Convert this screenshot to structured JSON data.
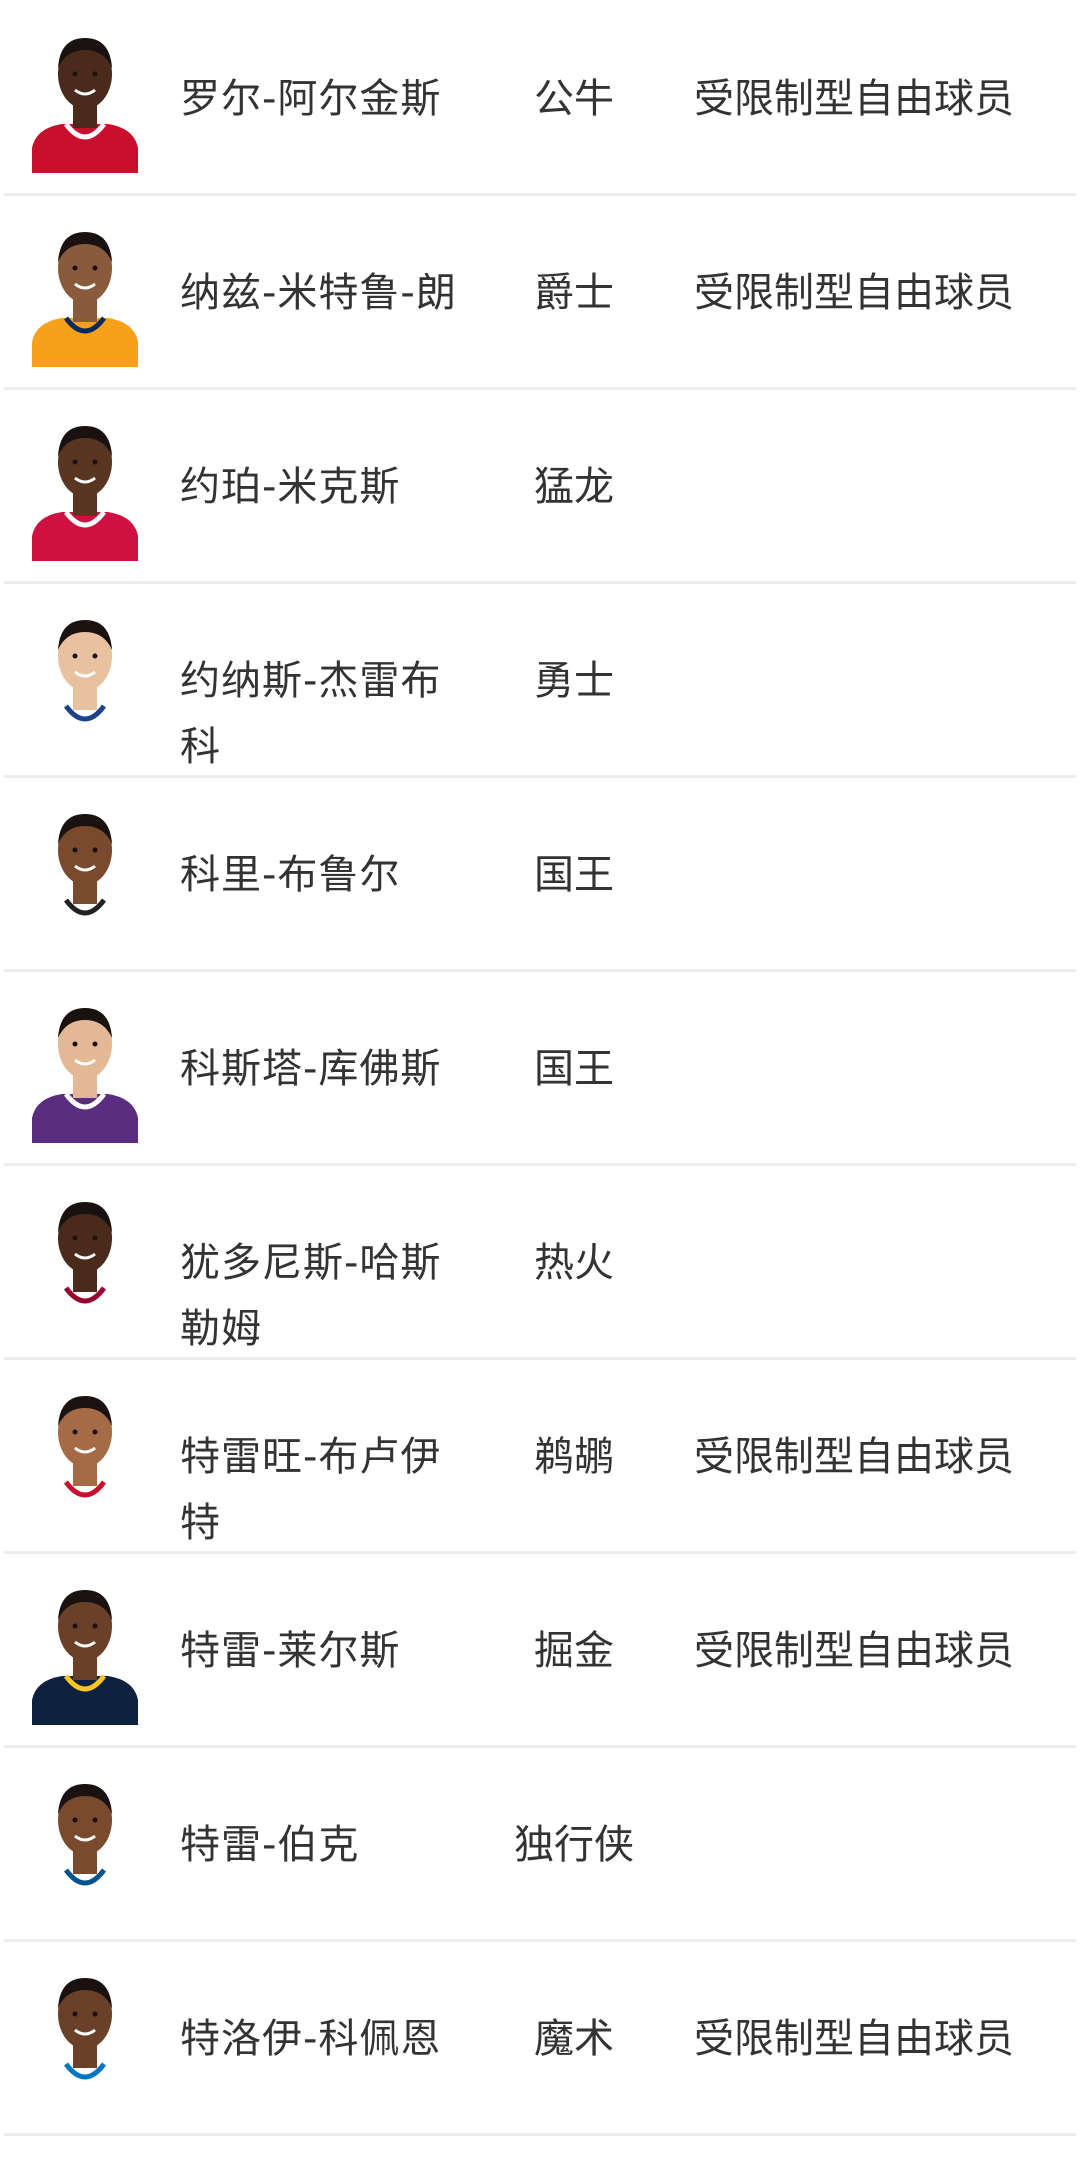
{
  "players": [
    {
      "name": "罗尔-阿尔金斯",
      "team": "公牛",
      "status": "受限制型自由球员",
      "skin": "#4a2a1a",
      "jersey": "#c8102e",
      "trim": "#ffffff"
    },
    {
      "name": "纳兹-米特鲁-朗",
      "team": "爵士",
      "status": "受限制型自由球员",
      "skin": "#8a5a3c",
      "jersey": "#f9a01b",
      "trim": "#002b5c"
    },
    {
      "name": "约珀-米克斯",
      "team": "猛龙",
      "status": "",
      "skin": "#5a3522",
      "jersey": "#ce1141",
      "trim": "#ffffff"
    },
    {
      "name": "约纳斯-杰雷布科",
      "team": "勇士",
      "status": "",
      "skin": "#e8c2a0",
      "jersey": "#ffffff",
      "trim": "#1d428a"
    },
    {
      "name": "科里-布鲁尔",
      "team": "国王",
      "status": "",
      "skin": "#7a4a2e",
      "jersey": "#ffffff",
      "trim": "#222222"
    },
    {
      "name": "科斯塔-库佛斯",
      "team": "国王",
      "status": "",
      "skin": "#e3b894",
      "jersey": "#5a2d81",
      "trim": "#ffffff"
    },
    {
      "name": "犹多尼斯-哈斯勒姆",
      "team": "热火",
      "status": "",
      "skin": "#4a2a1a",
      "jersey": "#ffffff",
      "trim": "#98002e"
    },
    {
      "name": "特雷旺-布卢伊特",
      "team": "鹈鹕",
      "status": "受限制型自由球员",
      "skin": "#a56b46",
      "jersey": "#ffffff",
      "trim": "#c8102e"
    },
    {
      "name": "特雷-莱尔斯",
      "team": "掘金",
      "status": "受限制型自由球员",
      "skin": "#6b4028",
      "jersey": "#0e2240",
      "trim": "#fec524"
    },
    {
      "name": "特雷-伯克",
      "team": "独行侠",
      "status": "",
      "skin": "#7a4a2e",
      "jersey": "#ffffff",
      "trim": "#00538c"
    },
    {
      "name": "特洛伊-科佩恩",
      "team": "魔术",
      "status": "受限制型自由球员",
      "skin": "#6b4028",
      "jersey": "#ffffff",
      "trim": "#0077c0"
    }
  ]
}
